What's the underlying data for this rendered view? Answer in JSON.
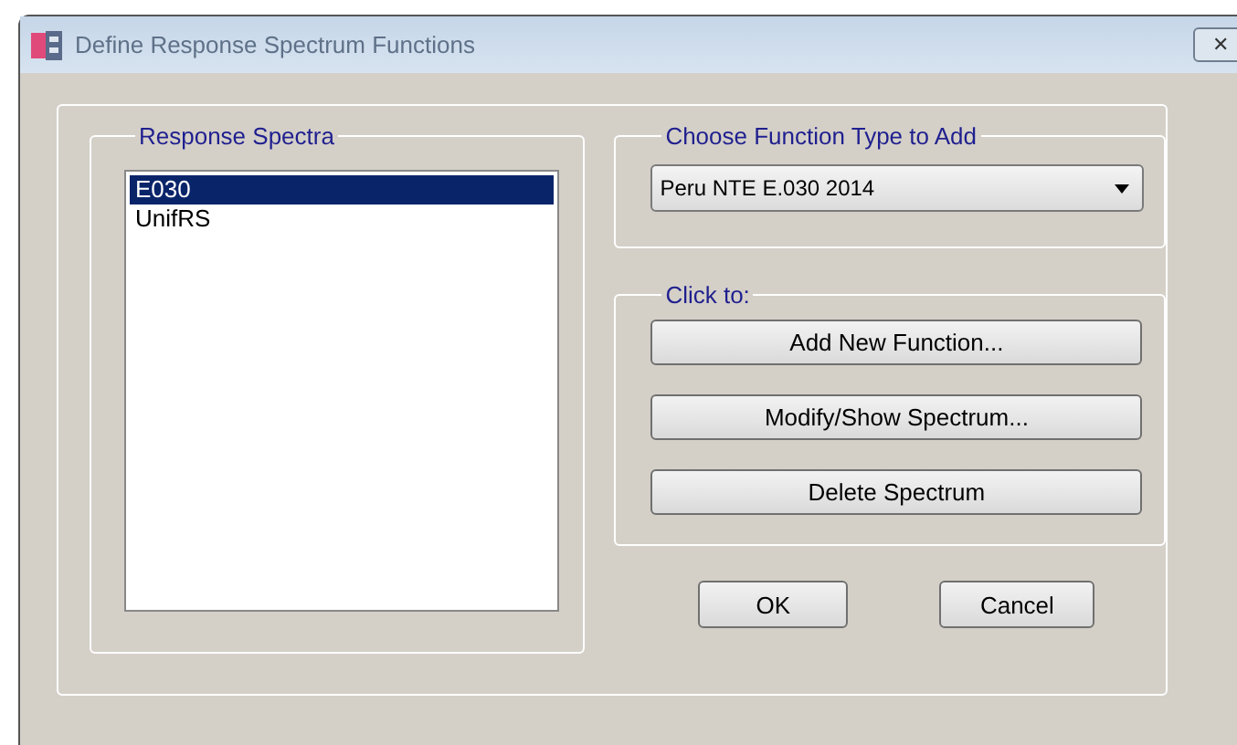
{
  "window": {
    "title": "Define Response Spectrum Functions",
    "close": "✕"
  },
  "response_spectra": {
    "label": "Response Spectra",
    "items": [
      {
        "name": "E030",
        "selected": true
      },
      {
        "name": "UnifRS",
        "selected": false
      }
    ]
  },
  "function_type": {
    "label": "Choose  Function Type to Add",
    "value": "Peru NTE E.030 2014"
  },
  "click_to": {
    "label": "Click to:",
    "buttons": [
      "Add New Function...",
      "Modify/Show Spectrum...",
      "Delete Spectrum"
    ]
  },
  "buttons": [
    "OK",
    "Cancel"
  ]
}
